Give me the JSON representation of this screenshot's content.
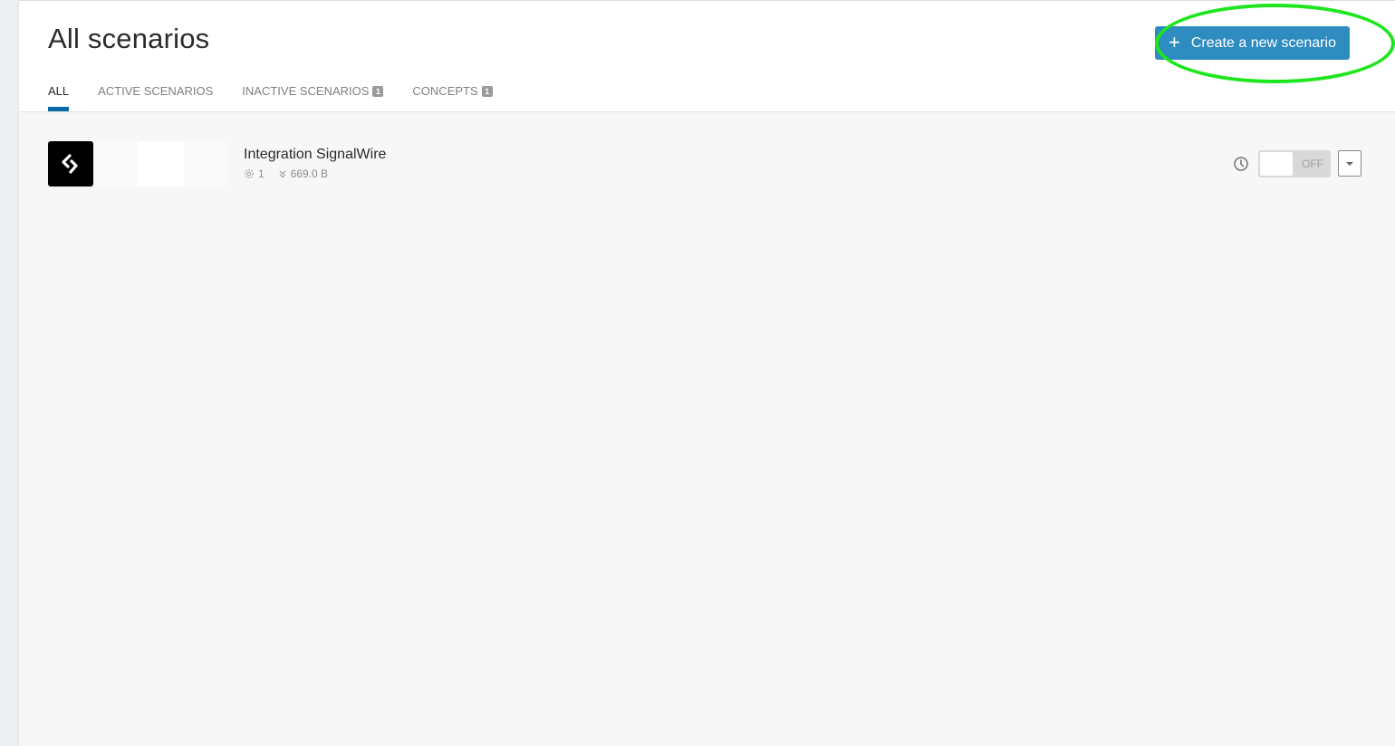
{
  "header": {
    "title": "All scenarios",
    "create_button_label": "Create a new scenario",
    "create_button_icon": "plus-icon"
  },
  "tabs": [
    {
      "label": "ALL",
      "active": true,
      "badge": null
    },
    {
      "label": "ACTIVE SCENARIOS",
      "active": false,
      "badge": null
    },
    {
      "label": "INACTIVE SCENARIOS",
      "active": false,
      "badge": "1"
    },
    {
      "label": "CONCEPTS",
      "active": false,
      "badge": "1"
    }
  ],
  "scenarios": [
    {
      "name": "Integration SignalWire",
      "app_icon": "signalwire-icon",
      "operations_count": "1",
      "data_transfer": "669.0 B",
      "status_label": "OFF",
      "active": false
    }
  ],
  "colors": {
    "accent": "#2f8cc0",
    "tab_indicator": "#0a6aa8",
    "highlight": "#1ee61e"
  }
}
